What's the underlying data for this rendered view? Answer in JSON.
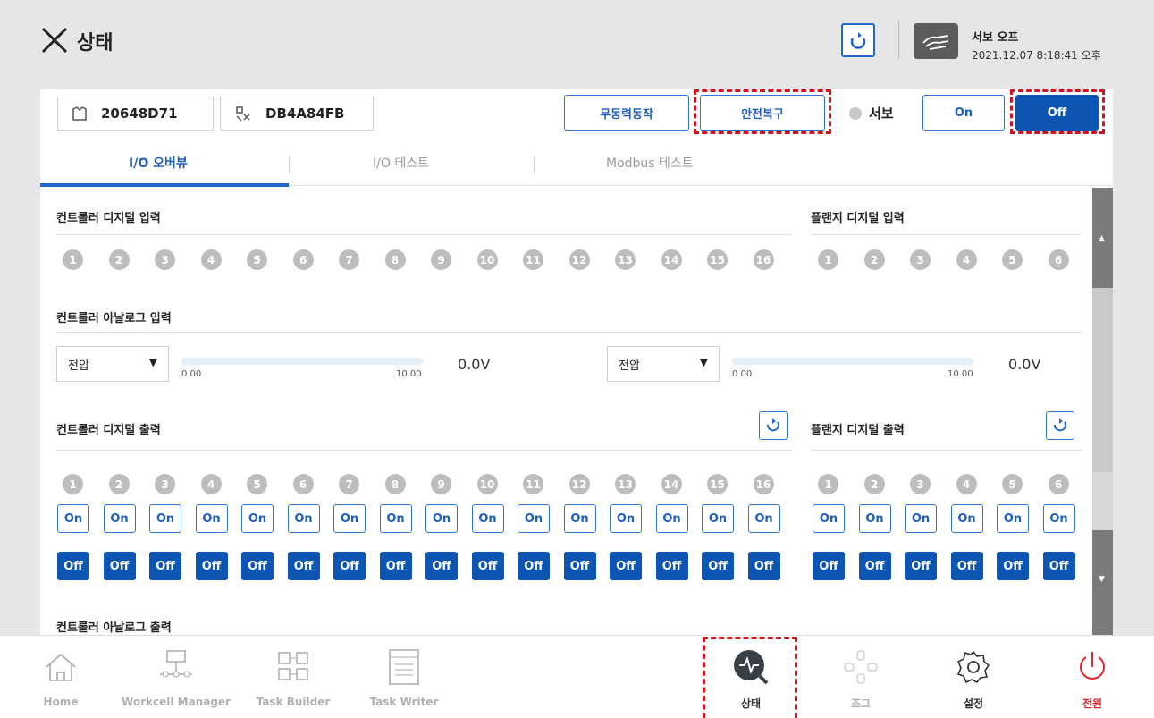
{
  "header": {
    "title": "상태",
    "servo_status": "서보 오프",
    "datetime": "2021.12.07 8:18:41 오후"
  },
  "toolbar": {
    "robot_id": "20648D71",
    "controller_id": "DB4A84FB",
    "freedrive": "무동력동작",
    "safety_recovery": "안전복구",
    "servo_label": "서보",
    "on": "On",
    "off": "Off"
  },
  "tabs": [
    {
      "label": "I/O 오버뷰"
    },
    {
      "label": "I/O 테스트"
    },
    {
      "label": "Modbus 테스트"
    }
  ],
  "sections": {
    "ctrl_di": "컨트롤러 디지털 입력",
    "flange_di": "플랜지 디지털 입력",
    "ctrl_ai": "컨트롤러 아날로그 입력",
    "ctrl_do": "컨트롤러 디지털 출력",
    "flange_do": "플랜지 디지털 출력",
    "ctrl_ao": "컨트롤러 아날로그 출력"
  },
  "analog": [
    {
      "mode": "전압",
      "min": "0.00",
      "max": "10.00",
      "value": "0.0V"
    },
    {
      "mode": "전압",
      "min": "0.00",
      "max": "10.00",
      "value": "0.0V"
    }
  ],
  "io": {
    "ctrl_count": 16,
    "flange_count": 6,
    "on": "On",
    "off": "Off"
  },
  "nav": [
    {
      "label": "Home",
      "icon": "home-icon"
    },
    {
      "label": "Workcell Manager",
      "icon": "workcell-icon"
    },
    {
      "label": "Task Builder",
      "icon": "task-builder-icon"
    },
    {
      "label": "Task Writer",
      "icon": "task-writer-icon"
    },
    {
      "label": "상태",
      "icon": "status-icon"
    },
    {
      "label": "조그",
      "icon": "jog-icon"
    },
    {
      "label": "설정",
      "icon": "settings-icon"
    },
    {
      "label": "전원",
      "icon": "power-icon"
    }
  ],
  "colors": {
    "accent": "#0c55b3",
    "power": "#e0262f",
    "highlight": "#d3121b"
  }
}
